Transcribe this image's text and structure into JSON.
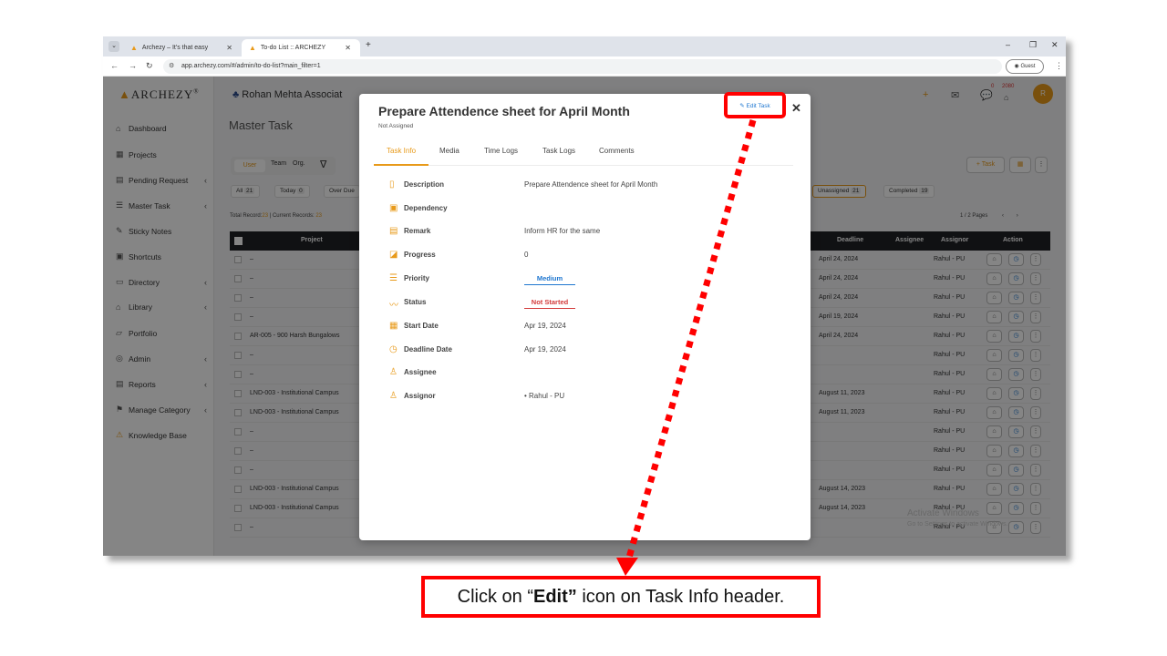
{
  "browser": {
    "tabs": [
      {
        "title": "Archezy – It's that easy"
      },
      {
        "title": "To-do List :: ARCHEZY"
      }
    ],
    "url_icon": "site-settings-icon",
    "url": "app.archezy.com/#/admin/to-do-list?main_filter=1",
    "profile_label": "Guest"
  },
  "sidebar": {
    "brand": "ARCHEZY",
    "brand_mark": "®",
    "items": [
      {
        "label": "Dashboard",
        "icon": "home-icon",
        "expandable": false
      },
      {
        "label": "Projects",
        "icon": "building-icon",
        "expandable": false
      },
      {
        "label": "Pending Request",
        "icon": "pending-icon",
        "expandable": true
      },
      {
        "label": "Master Task",
        "icon": "list-icon",
        "expandable": true
      },
      {
        "label": "Sticky Notes",
        "icon": "note-icon",
        "expandable": false
      },
      {
        "label": "Shortcuts",
        "icon": "shortcut-icon",
        "expandable": false
      },
      {
        "label": "Directory",
        "icon": "directory-icon",
        "expandable": true
      },
      {
        "label": "Library",
        "icon": "library-icon",
        "expandable": true
      },
      {
        "label": "Portfolio",
        "icon": "portfolio-icon",
        "expandable": false
      },
      {
        "label": "Admin",
        "icon": "admin-icon",
        "expandable": true
      },
      {
        "label": "Reports",
        "icon": "reports-icon",
        "expandable": true
      },
      {
        "label": "Manage Category",
        "icon": "category-icon",
        "expandable": true
      },
      {
        "label": "Knowledge Base",
        "icon": "knowledge-icon",
        "expandable": false
      }
    ]
  },
  "header": {
    "company": "Rohan Mehta Associat",
    "page_title": "Master Task",
    "notification_count": "0",
    "points": "2080",
    "avatar_letter": "R"
  },
  "filters": {
    "segments": [
      "User",
      "Team",
      "Org."
    ],
    "search_placeholder": "Search",
    "chips": [
      {
        "label": "All",
        "count": "21"
      },
      {
        "label": "Today",
        "count": "0"
      },
      {
        "label": "Over Due",
        "count": ""
      },
      {
        "label": "Unassigned",
        "count": "21"
      },
      {
        "label": "Completed",
        "count": "19"
      }
    ],
    "add_task_label": "+ Task"
  },
  "records": {
    "total_label": "Total Record:",
    "total": "23",
    "current_label": "| Current Records:",
    "current": "23",
    "pages": "1 / 2 Pages"
  },
  "table": {
    "columns": [
      "Project",
      "Deadline",
      "Assignee",
      "Assignor",
      "Action"
    ],
    "rows": [
      {
        "project": "–",
        "deadline": "April 24, 2024",
        "assignor": "Rahul - PU"
      },
      {
        "project": "–",
        "deadline": "April 24, 2024",
        "assignor": "Rahul - PU"
      },
      {
        "project": "–",
        "deadline": "April 24, 2024",
        "assignor": "Rahul - PU"
      },
      {
        "project": "–",
        "deadline": "April 19, 2024",
        "assignor": "Rahul - PU"
      },
      {
        "project": "AR-005 - 900 Harsh Bungalows",
        "deadline": "April 24, 2024",
        "assignor": "Rahul - PU"
      },
      {
        "project": "–",
        "deadline": "",
        "assignor": "Rahul - PU"
      },
      {
        "project": "–",
        "deadline": "",
        "assignor": "Rahul - PU"
      },
      {
        "project": "LND-003 - Institutional Campus",
        "deadline": "August 11, 2023",
        "assignor": "Rahul - PU"
      },
      {
        "project": "LND-003 - Institutional Campus",
        "deadline": "August 11, 2023",
        "assignor": "Rahul - PU"
      },
      {
        "project": "–",
        "deadline": "",
        "assignor": "Rahul - PU"
      },
      {
        "project": "–",
        "deadline": "",
        "assignor": "Rahul - PU"
      },
      {
        "project": "–",
        "deadline": "",
        "assignor": "Rahul - PU"
      },
      {
        "project": "LND-003 - Institutional Campus",
        "deadline": "August 14, 2023",
        "assignor": "Rahul - PU"
      },
      {
        "project": "LND-003 - Institutional Campus",
        "deadline": "August 14, 2023",
        "assignor": "Rahul - PU"
      },
      {
        "project": "–",
        "deadline": "",
        "assignor": "Rahul - PU"
      }
    ]
  },
  "watermark": {
    "line1": "Activate Windows",
    "line2": "Go to Settings to activate Windows."
  },
  "modal": {
    "title": "Prepare Attendence sheet for April Month",
    "subtitle": "Not Assigned",
    "edit_label": "Edit Task",
    "tabs": [
      "Task Info",
      "Media",
      "Time Logs",
      "Task Logs",
      "Comments"
    ],
    "fields": [
      {
        "label": "Description",
        "value": "Prepare Attendence sheet for April Month",
        "icon": "description-icon"
      },
      {
        "label": "Dependency",
        "value": "",
        "icon": "dependency-icon"
      },
      {
        "label": "Remark",
        "value": "Inform HR for the same",
        "icon": "remark-icon"
      },
      {
        "label": "Progress",
        "value": "0",
        "icon": "progress-icon"
      },
      {
        "label": "Priority",
        "value": "Medium",
        "icon": "priority-icon"
      },
      {
        "label": "Status",
        "value": "Not Started",
        "icon": "status-icon"
      },
      {
        "label": "Start Date",
        "value": "Apr 19, 2024",
        "icon": "calendar-icon"
      },
      {
        "label": "Deadline Date",
        "value": "Apr 19, 2024",
        "icon": "deadline-icon"
      },
      {
        "label": "Assignee",
        "value": "",
        "icon": "assignee-icon"
      },
      {
        "label": "Assignor",
        "value": "• Rahul - PU",
        "icon": "assignor-icon"
      }
    ]
  },
  "annotation": {
    "prefix": "Click on “",
    "bold": "Edit”",
    "suffix": " icon on Task Info header.",
    "color": "#ff0000"
  }
}
